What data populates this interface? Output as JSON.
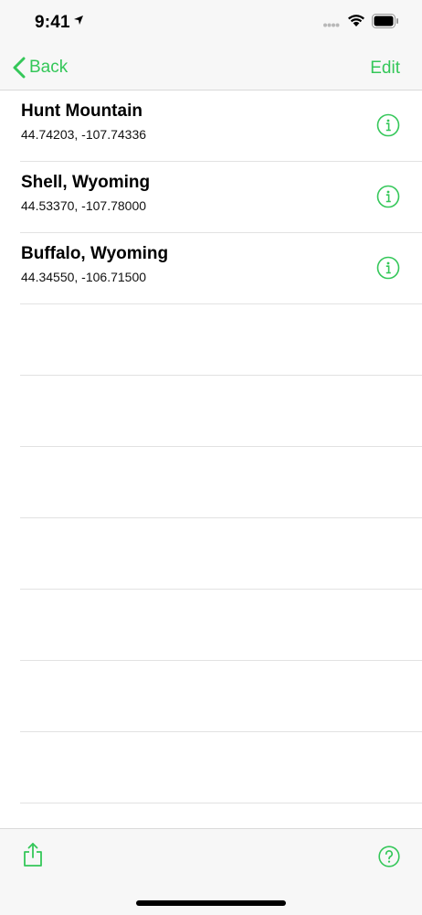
{
  "status_bar": {
    "time": "9:41"
  },
  "nav": {
    "back_label": "Back",
    "edit_label": "Edit"
  },
  "locations": [
    {
      "name": "Hunt Mountain",
      "coords": "44.74203, -107.74336"
    },
    {
      "name": "Shell, Wyoming",
      "coords": "44.53370, -107.78000"
    },
    {
      "name": "Buffalo, Wyoming",
      "coords": "44.34550, -106.71500"
    }
  ],
  "colors": {
    "accent": "#34c759"
  },
  "icons": {
    "back": "chevron-left-icon",
    "info": "info-circle-icon",
    "share": "share-icon",
    "help": "question-circle-icon"
  }
}
